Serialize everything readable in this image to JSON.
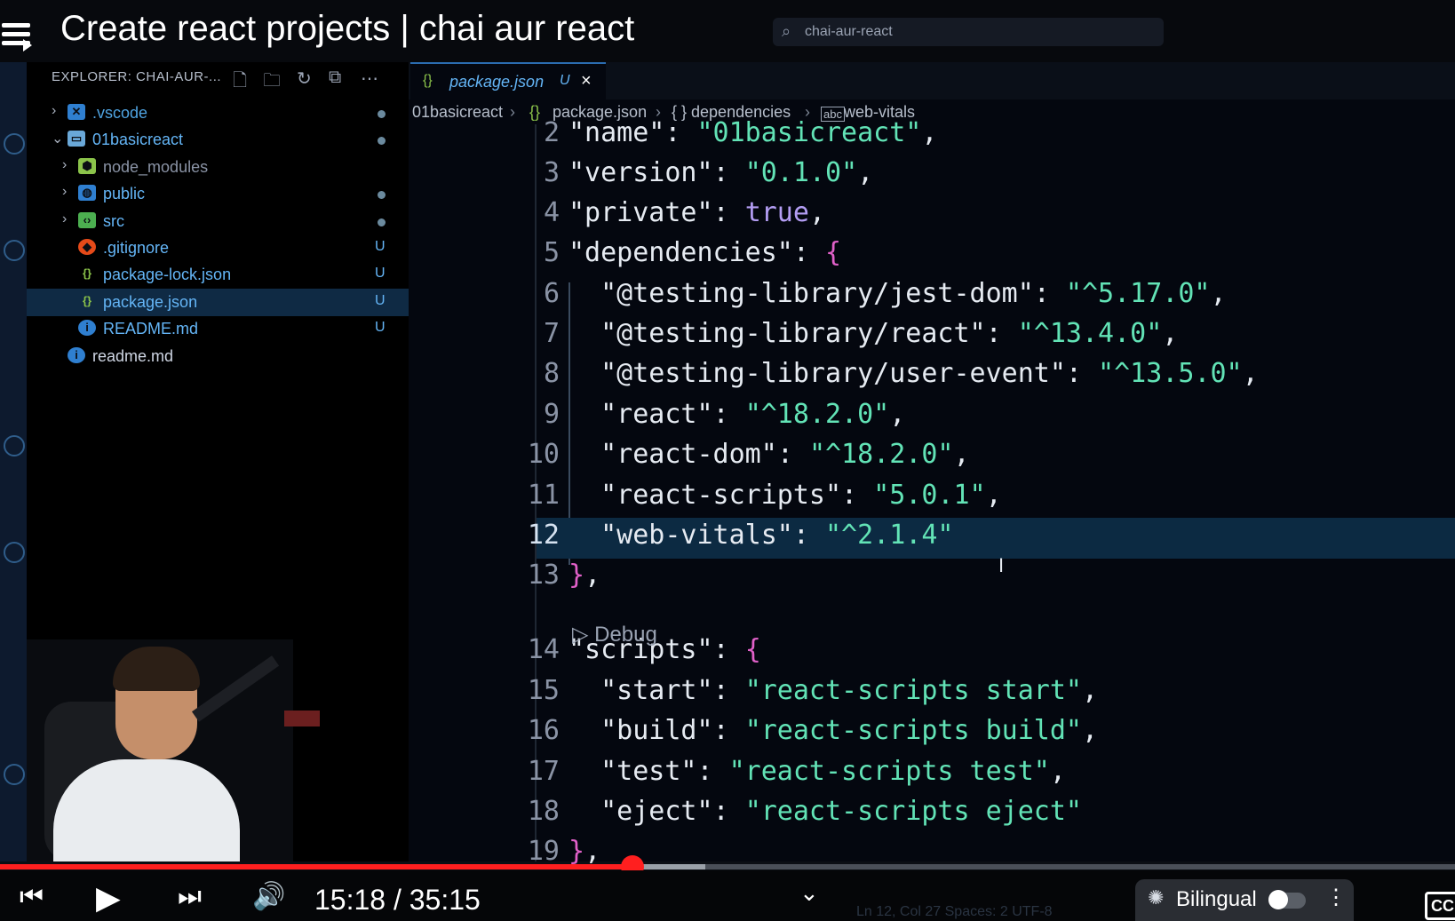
{
  "video": {
    "title": "Create react projects | chai aur react",
    "current_time": "15:18",
    "duration": "35:15",
    "time_display": "15:18 / 35:15",
    "progress_fraction": 0.4345,
    "buffered_fraction": 0.485,
    "bilingual_label": "Bilingual",
    "cc_label": "CC"
  },
  "search": {
    "placeholder": "chai-aur-react"
  },
  "explorer": {
    "title": "EXPLORER: CHAI-AUR-...",
    "items": [
      {
        "label": ".vscode",
        "status": "dot",
        "kind": "folder-vscode",
        "color": "#4fa3e0"
      },
      {
        "label": "01basicreact",
        "status": "dot",
        "kind": "folder-open",
        "color": "#64b5f6"
      },
      {
        "label": "node_modules",
        "status": "",
        "kind": "folder-node",
        "color": "#8a93a5"
      },
      {
        "label": "public",
        "status": "dot",
        "kind": "folder-public",
        "color": "#64b5f6"
      },
      {
        "label": "src",
        "status": "dot",
        "kind": "folder-src",
        "color": "#64b5f6"
      },
      {
        "label": ".gitignore",
        "status": "U",
        "kind": "git",
        "color": "#64b5f6"
      },
      {
        "label": "package-lock.json",
        "status": "U",
        "kind": "json",
        "color": "#64b5f6"
      },
      {
        "label": "package.json",
        "status": "U",
        "kind": "json",
        "color": "#64b5f6"
      },
      {
        "label": "README.md",
        "status": "U",
        "kind": "info",
        "color": "#64b5f6"
      },
      {
        "label": "readme.md",
        "status": "",
        "kind": "info",
        "color": "#cfd6e4"
      }
    ]
  },
  "editor": {
    "tab_label": "package.json",
    "tab_status": "U",
    "breadcrumb": [
      "01basicreact",
      "package.json",
      "{ } dependencies",
      "web-vitals"
    ],
    "codelens": "Debug",
    "cursor_line": "12",
    "lines": [
      {
        "n": "2",
        "parts": [
          [
            "\"name\"",
            "k"
          ],
          [
            ": ",
            "p"
          ],
          [
            "\"01basicreact\"",
            "s"
          ],
          [
            ",",
            "p"
          ]
        ]
      },
      {
        "n": "3",
        "parts": [
          [
            "\"version\"",
            "k"
          ],
          [
            ": ",
            "p"
          ],
          [
            "\"0.1.0\"",
            "s"
          ],
          [
            ",",
            "p"
          ]
        ]
      },
      {
        "n": "4",
        "parts": [
          [
            "\"private\"",
            "k"
          ],
          [
            ": ",
            "p"
          ],
          [
            "true",
            "b"
          ],
          [
            ",",
            "p"
          ]
        ]
      },
      {
        "n": "5",
        "parts": [
          [
            "\"dependencies\"",
            "k"
          ],
          [
            ": ",
            "p"
          ],
          [
            "{",
            "br"
          ]
        ]
      },
      {
        "n": "6",
        "parts": [
          [
            "  \"@testing-library/jest-dom\"",
            "k"
          ],
          [
            ": ",
            "p"
          ],
          [
            "\"^5.17.0\"",
            "s"
          ],
          [
            ",",
            "p"
          ]
        ]
      },
      {
        "n": "7",
        "parts": [
          [
            "  \"@testing-library/react\"",
            "k"
          ],
          [
            ": ",
            "p"
          ],
          [
            "\"^13.4.0\"",
            "s"
          ],
          [
            ",",
            "p"
          ]
        ]
      },
      {
        "n": "8",
        "parts": [
          [
            "  \"@testing-library/user-event\"",
            "k"
          ],
          [
            ": ",
            "p"
          ],
          [
            "\"^13.5.0\"",
            "s"
          ],
          [
            ",",
            "p"
          ]
        ]
      },
      {
        "n": "9",
        "parts": [
          [
            "  \"react\"",
            "k"
          ],
          [
            ": ",
            "p"
          ],
          [
            "\"^18.2.0\"",
            "s"
          ],
          [
            ",",
            "p"
          ]
        ]
      },
      {
        "n": "10",
        "parts": [
          [
            "  \"react-dom\"",
            "k"
          ],
          [
            ": ",
            "p"
          ],
          [
            "\"^18.2.0\"",
            "s"
          ],
          [
            ",",
            "p"
          ]
        ]
      },
      {
        "n": "11",
        "parts": [
          [
            "  \"react-scripts\"",
            "k"
          ],
          [
            ": ",
            "p"
          ],
          [
            "\"5.0.1\"",
            "s"
          ],
          [
            ",",
            "p"
          ]
        ]
      },
      {
        "n": "12",
        "parts": [
          [
            "  \"web-vitals\"",
            "k"
          ],
          [
            ": ",
            "p"
          ],
          [
            "\"^2.1.4\"",
            "s"
          ]
        ]
      },
      {
        "n": "13",
        "parts": [
          [
            "}",
            "br"
          ],
          [
            ",",
            "p"
          ]
        ]
      },
      {
        "n": "14",
        "parts": [
          [
            "\"scripts\"",
            "k"
          ],
          [
            ": ",
            "p"
          ],
          [
            "{",
            "br"
          ]
        ]
      },
      {
        "n": "15",
        "parts": [
          [
            "  \"start\"",
            "k"
          ],
          [
            ": ",
            "p"
          ],
          [
            "\"react-scripts start\"",
            "s"
          ],
          [
            ",",
            "p"
          ]
        ]
      },
      {
        "n": "16",
        "parts": [
          [
            "  \"build\"",
            "k"
          ],
          [
            ": ",
            "p"
          ],
          [
            "\"react-scripts build\"",
            "s"
          ],
          [
            ",",
            "p"
          ]
        ]
      },
      {
        "n": "17",
        "parts": [
          [
            "  \"test\"",
            "k"
          ],
          [
            ": ",
            "p"
          ],
          [
            "\"react-scripts test\"",
            "s"
          ],
          [
            ",",
            "p"
          ]
        ]
      },
      {
        "n": "18",
        "parts": [
          [
            "  \"eject\"",
            "k"
          ],
          [
            ": ",
            "p"
          ],
          [
            "\"react-scripts eject\"",
            "s"
          ]
        ]
      },
      {
        "n": "19",
        "parts": [
          [
            "}",
            "br"
          ],
          [
            ",",
            "p"
          ]
        ]
      }
    ]
  },
  "statusbar": {
    "text": "Ln 12, Col 27    Spaces: 2    UTF-8"
  },
  "colors": {
    "accent": "#ff1f1f",
    "json_key": "#e6ebf2",
    "json_string": "#62e3b6",
    "json_bool": "#b39df3",
    "bracket": "#e060c8"
  }
}
